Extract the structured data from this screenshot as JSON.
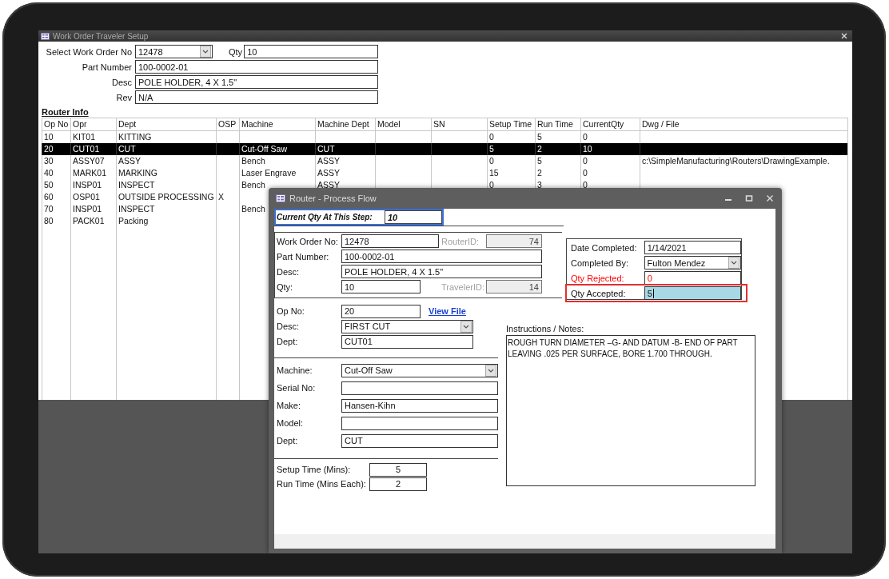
{
  "main_window": {
    "title": "Work Order Traveler Setup",
    "work_order": {
      "label": "Select Work Order No",
      "value": "12478"
    },
    "qty": {
      "label": "Qty",
      "value": "10"
    },
    "part_number": {
      "label": "Part Number",
      "value": "100-0002-01"
    },
    "desc": {
      "label": "Desc",
      "value": "POLE HOLDER, 4 X 1.5\""
    },
    "rev": {
      "label": "Rev",
      "value": "N/A"
    },
    "section_title": "Router Info",
    "table": {
      "columns": [
        "Op No",
        "Opr",
        "Dept",
        "OSP",
        "Machine",
        "Machine Dept",
        "Model",
        "SN",
        "Setup Time",
        "Run Time",
        "CurrentQty",
        "Dwg / File"
      ],
      "rows": [
        {
          "selected": false,
          "cells": [
            "10",
            "KIT01",
            "KITTING",
            null,
            null,
            null,
            null,
            null,
            "0",
            "5",
            "0",
            null
          ]
        },
        {
          "selected": true,
          "cells": [
            "20",
            "CUT01",
            "CUT",
            null,
            "Cut-Off Saw",
            "CUT",
            null,
            null,
            "5",
            "2",
            "10",
            null
          ]
        },
        {
          "selected": false,
          "cells": [
            "30",
            "ASSY07",
            "ASSY",
            null,
            "Bench",
            "ASSY",
            null,
            null,
            "0",
            "5",
            "0",
            "c:\\SimpleManufacturing\\Routers\\DrawingExample."
          ]
        },
        {
          "selected": false,
          "cells": [
            "40",
            "MARK01",
            "MARKING",
            null,
            "Laser Engrave",
            "ASSY",
            null,
            null,
            "15",
            "2",
            "0",
            null
          ]
        },
        {
          "selected": false,
          "cells": [
            "50",
            "INSP01",
            "INSPECT",
            null,
            "Bench",
            "ASSY",
            null,
            null,
            "0",
            "3",
            "0",
            null
          ]
        },
        {
          "selected": false,
          "cells": [
            "60",
            "OSP01",
            "OUTSIDE PROCESSING",
            "X",
            null,
            null,
            null,
            null,
            null,
            null,
            null,
            null
          ]
        },
        {
          "selected": false,
          "cells": [
            "70",
            "INSP01",
            "INSPECT",
            null,
            "Bench",
            null,
            null,
            null,
            null,
            null,
            null,
            null
          ]
        },
        {
          "selected": false,
          "cells": [
            "80",
            "PACK01",
            "Packing",
            null,
            null,
            null,
            null,
            null,
            null,
            null,
            null,
            null
          ]
        }
      ]
    }
  },
  "dialog": {
    "title": "Router - Process Flow",
    "current_qty": {
      "label": "Current Qty At This Step:",
      "value": "10"
    },
    "work_order_no": {
      "label": "Work Order No:",
      "value": "12478"
    },
    "router_id": {
      "label": "RouterID:",
      "value": "74",
      "disabled": true
    },
    "part_number": {
      "label": "Part Number:",
      "value": "100-0002-01"
    },
    "desc": {
      "label": "Desc:",
      "value": "POLE HOLDER, 4 X 1.5\""
    },
    "qty": {
      "label": "Qty:",
      "value": "10"
    },
    "traveler_id": {
      "label": "TravelerID:",
      "value": "14",
      "disabled": true
    },
    "completion": [
      {
        "label": "Date Completed:",
        "value": "1/14/2021",
        "kind": "text",
        "focused": false
      },
      {
        "label": "Completed By:",
        "value": "Fulton Mendez",
        "kind": "combo",
        "focused": false
      },
      {
        "label": "Qty Rejected:",
        "value": "0",
        "kind": "text",
        "color": "#ff0000",
        "focused": false
      },
      {
        "label": "Qty Accepted:",
        "value": "5",
        "kind": "text",
        "focused": true
      }
    ],
    "operation": [
      {
        "label": "Op No:",
        "value": "20",
        "kind": "short"
      },
      {
        "label": "Desc:",
        "value": "FIRST CUT",
        "kind": "combo"
      },
      {
        "label": "Dept:",
        "value": "CUT01",
        "kind": "text"
      }
    ],
    "view_file": "View File",
    "machine": [
      {
        "label": "Machine:",
        "value": "Cut-Off Saw",
        "kind": "combo"
      },
      {
        "label": "Serial No:",
        "kind": "text"
      },
      {
        "label": "Make:",
        "value": "Hansen-Kihn",
        "kind": "text"
      },
      {
        "label": "Model:",
        "kind": "text"
      },
      {
        "label": "Dept:",
        "value": "CUT",
        "kind": "text"
      }
    ],
    "times": [
      {
        "label": "Setup Time (Mins):",
        "value": "5"
      },
      {
        "label": "Run Time (Mins Each):",
        "value": "2"
      }
    ],
    "notes": {
      "label": "Instructions / Notes:",
      "text": "ROUGH TURN DIAMETER –G- AND DATUM -B- END OF PART LEAVING .025 PER SURFACE, BORE 1.700 THROUGH."
    }
  }
}
